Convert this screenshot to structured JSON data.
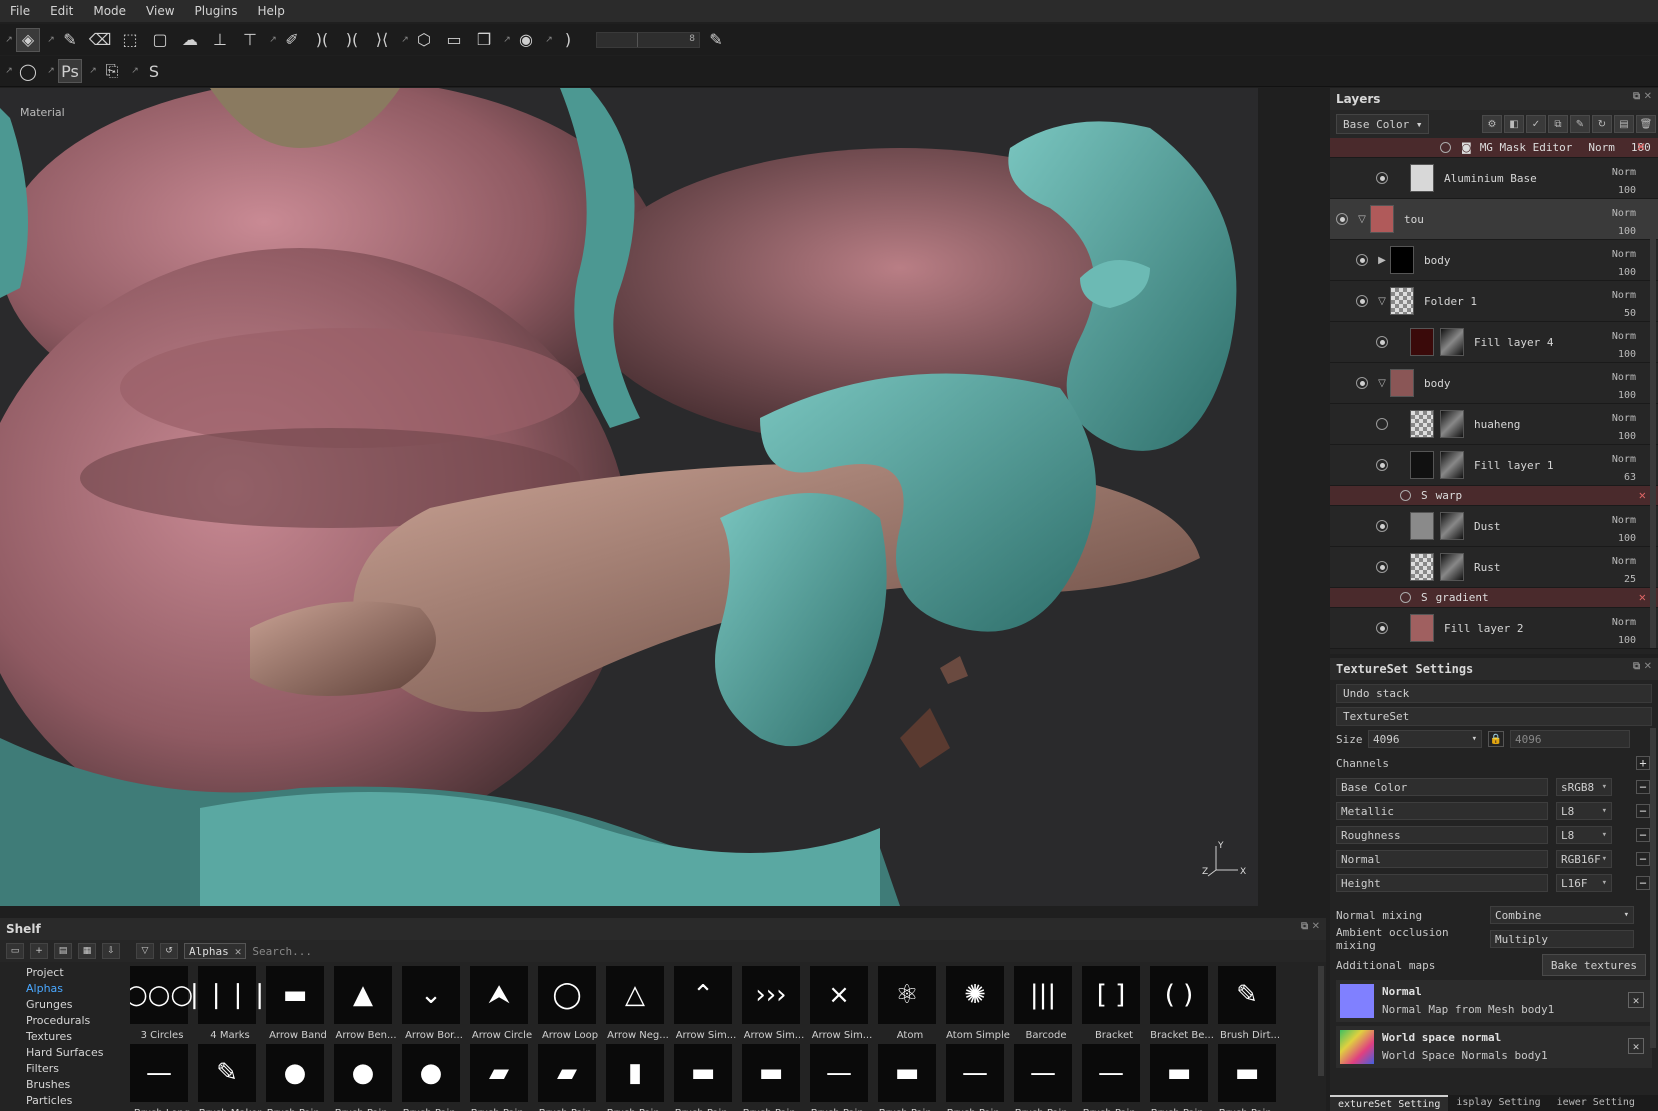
{
  "menu": [
    "File",
    "Edit",
    "Mode",
    "View",
    "Plugins",
    "Help"
  ],
  "toolbar": {
    "slider_value": "8"
  },
  "viewport": {
    "label": "Material",
    "axis_y": "Y",
    "axis_x": "X",
    "axis_z": "Z"
  },
  "layers": {
    "title": "Layers",
    "channel_dropdown": "Base Color",
    "mask_editor": {
      "name": "MG Mask Editor",
      "blend": "Norm",
      "opacity": "100"
    },
    "rows": [
      {
        "name": "Aluminium Base",
        "blend": "Norm",
        "opacity": "100",
        "thumb": "#d8d8d8",
        "visible": true,
        "indent": 2,
        "folder": ""
      },
      {
        "name": "tou",
        "blend": "Norm",
        "opacity": "100",
        "thumb": "#b05a5a",
        "visible": true,
        "indent": 0,
        "folder": "open",
        "selected": true
      },
      {
        "name": "body",
        "blend": "Norm",
        "opacity": "100",
        "thumb": "#000000",
        "visible": true,
        "indent": 1,
        "folder": "closed"
      },
      {
        "name": "Folder 1",
        "blend": "Norm",
        "opacity": "50",
        "thumb": "checker",
        "visible": true,
        "indent": 1,
        "folder": "open"
      },
      {
        "name": "Fill layer 4",
        "blend": "Norm",
        "opacity": "100",
        "thumb": "#3a0a0a",
        "mask": true,
        "visible": true,
        "indent": 2,
        "folder": ""
      },
      {
        "name": "body",
        "blend": "Norm",
        "opacity": "100",
        "thumb": "#8a5656",
        "visible": true,
        "indent": 1,
        "folder": "open"
      },
      {
        "name": "huaheng",
        "blend": "Norm",
        "opacity": "100",
        "thumb": "checker",
        "mask": true,
        "visible": false,
        "indent": 2,
        "folder": ""
      },
      {
        "name": "Fill layer 1",
        "blend": "Norm",
        "opacity": "63",
        "thumb": "#111111",
        "mask": true,
        "visible": true,
        "indent": 2,
        "folder": "",
        "effect": "warp"
      },
      {
        "name": "Dust",
        "blend": "Norm",
        "opacity": "100",
        "thumb": "#8a8a8a",
        "mask": true,
        "visible": true,
        "indent": 2,
        "folder": ""
      },
      {
        "name": "Rust",
        "blend": "Norm",
        "opacity": "25",
        "thumb": "checker",
        "mask": true,
        "visible": true,
        "indent": 2,
        "folder": "",
        "effect": "gradient"
      },
      {
        "name": "Fill layer 2",
        "blend": "Norm",
        "opacity": "100",
        "thumb": "#a06060",
        "visible": true,
        "indent": 2,
        "folder": ""
      }
    ]
  },
  "textureset": {
    "title": "TextureSet Settings",
    "undo_stack": "Undo stack",
    "textureset_label": "TextureSet",
    "size_label": "Size",
    "size_value": "4096",
    "size_value2": "4096",
    "channels_label": "Channels",
    "channels": [
      {
        "name": "Base Color",
        "format": "sRGB8"
      },
      {
        "name": "Metallic",
        "format": "L8"
      },
      {
        "name": "Roughness",
        "format": "L8"
      },
      {
        "name": "Normal",
        "format": "RGB16F"
      },
      {
        "name": "Height",
        "format": "L16F"
      }
    ],
    "normal_mixing_label": "Normal mixing",
    "normal_mixing_value": "Combine",
    "ao_mixing_label": "Ambient occlusion mixing",
    "ao_mixing_value": "Multiply",
    "additional_maps_label": "Additional maps",
    "bake_button": "Bake textures",
    "maps": [
      {
        "title": "Normal",
        "subtitle": "Normal Map from Mesh body1",
        "color": "#8080ff"
      },
      {
        "title": "World space normal",
        "subtitle": "World Space Normals body1",
        "color": "rainbow"
      }
    ],
    "tabs": [
      "extureSet Setting",
      "isplay Setting",
      "iewer Setting"
    ]
  },
  "shelf": {
    "title": "Shelf",
    "filter_tag": "Alphas",
    "search_placeholder": "Search...",
    "categories": [
      "Project",
      "Alphas",
      "Grunges",
      "Procedurals",
      "Textures",
      "Hard Surfaces",
      "Filters",
      "Brushes",
      "Particles"
    ],
    "active_category": "Alphas",
    "row1": [
      {
        "label": "3 Circles",
        "glyph": "○○○"
      },
      {
        "label": "4 Marks",
        "glyph": "❘❘❘❘"
      },
      {
        "label": "Arrow Band",
        "glyph": "▬"
      },
      {
        "label": "Arrow Ben...",
        "glyph": "▲"
      },
      {
        "label": "Arrow Bor...",
        "glyph": "⌄"
      },
      {
        "label": "Arrow Circle",
        "glyph": "⮝"
      },
      {
        "label": "Arrow Loop",
        "glyph": "◯"
      },
      {
        "label": "Arrow Neg...",
        "glyph": "△"
      },
      {
        "label": "Arrow Sim...",
        "glyph": "⌃"
      },
      {
        "label": "Arrow Sim...",
        "glyph": "›››"
      },
      {
        "label": "Arrow Sim...",
        "glyph": "⨯"
      },
      {
        "label": "Atom",
        "glyph": "⚛"
      },
      {
        "label": "Atom Simple",
        "glyph": "✺"
      },
      {
        "label": "Barcode",
        "glyph": "|||"
      },
      {
        "label": "Bracket",
        "glyph": "[ ]"
      },
      {
        "label": "Bracket Be...",
        "glyph": "( )"
      },
      {
        "label": "Brush Dirt...",
        "glyph": "✎"
      }
    ],
    "row2": [
      {
        "label": "Brush Long",
        "glyph": "—"
      },
      {
        "label": "Brush Maker",
        "glyph": "✎"
      },
      {
        "label": "Brush Pain...",
        "glyph": "●"
      },
      {
        "label": "Brush Pain...",
        "glyph": "●"
      },
      {
        "label": "Brush Pain...",
        "glyph": "●"
      },
      {
        "label": "Brush Pain...",
        "glyph": "▰"
      },
      {
        "label": "Brush Pain...",
        "glyph": "▰"
      },
      {
        "label": "Brush Pain...",
        "glyph": "▮"
      },
      {
        "label": "Brush Pain...",
        "glyph": "▬"
      },
      {
        "label": "Brush Pain...",
        "glyph": "▬"
      },
      {
        "label": "Brush Pain...",
        "glyph": "—"
      },
      {
        "label": "Brush Pain...",
        "glyph": "▬"
      },
      {
        "label": "Brush Pain...",
        "glyph": "—"
      },
      {
        "label": "Brush Pain...",
        "glyph": "—"
      },
      {
        "label": "Brush Pain...",
        "glyph": "—"
      },
      {
        "label": "Brush Pain...",
        "glyph": "▬"
      },
      {
        "label": "Brush Pain...",
        "glyph": "▬"
      }
    ]
  }
}
